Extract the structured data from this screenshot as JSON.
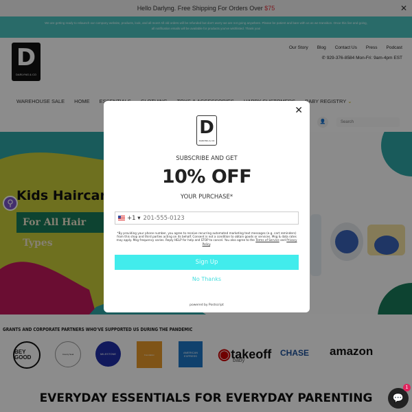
{
  "announcement": {
    "text": "Hello Darlyng. Free Shipping For Orders Over ",
    "price": "$75",
    "close_icon": "close-icon"
  },
  "notice": {
    "line1": "We are getting ready to relaunch our company website, products, look, and all more! All old orders will be refunded but don't worry we are not going anywhere. Please be patient and bare with us as we transition. Once this live and going,",
    "line2": "all notification emails will be available for products you've wishlisted. Thank you!"
  },
  "brand": {
    "logo_letter": "D",
    "logo_text": "DARLYNG & CO"
  },
  "header": {
    "links": [
      "Our Story",
      "Blog",
      "Contact Us",
      "Press",
      "Podcast"
    ],
    "phone": "929-376-8584 Mon-Fri: 9am-4pm EST"
  },
  "nav": [
    "WAREHOUSE SALE",
    "HOME",
    "ESSENTIALS",
    "CLOTHING",
    "TOYS & ACCESSORIES",
    "HAPPY CUSTOMERS",
    "BABY REGISTRY"
  ],
  "search": {
    "placeholder": "Search"
  },
  "hero": {
    "title": "Kids Haircare",
    "subtitle": "For All Hair Types"
  },
  "partners": {
    "title": "GRANTS AND CORPORATE PARTNERS WHO'VE SUPPORTED US DURING THE PANDEMIC",
    "logos": [
      "BEY GOOD",
      "County Seal",
      "MILESTONE",
      "Foundation",
      "AMERICAN EXPRESS",
      "takeoff",
      "baby",
      "CHASE",
      "amazon"
    ]
  },
  "headline": "EVERYDAY ESSENTIALS FOR EVERYDAY PARENTING",
  "chat": {
    "badge": "1"
  },
  "modal": {
    "line1": "SUBSCRIBE AND GET",
    "line2": "10% OFF",
    "line3": "YOUR PURCHASE*",
    "country_code": "+1",
    "phone_placeholder": "201-555-0123",
    "legal": "*By providing your phone number, you agree to receive recurring automated marketing text messages (e.g. cart reminders) from this shop and third parties acting on its behalf. Consent is not a condition to obtain goods or services. Msg & data rates may apply. Msg frequency varies. Reply HELP for help and STOP to cancel. You also agree to the ",
    "terms": "Terms of Service",
    "and": " and ",
    "privacy": "Privacy Policy",
    "period": ".",
    "signup": "Sign Up",
    "no_thanks": "No Thanks",
    "powered": "powered by Postscript"
  },
  "colors": {
    "teal": "#4cc3c0",
    "signup": "#42ecec",
    "price": "#e2313b"
  }
}
